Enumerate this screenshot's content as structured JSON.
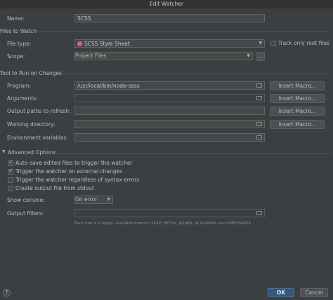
{
  "window": {
    "title": "Edit Watcher"
  },
  "name": {
    "label": "Name:",
    "value": "SCSS"
  },
  "files_to_watch": {
    "header": "Files to Watch",
    "file_type_label": "File type:",
    "file_type_value": "SCSS Style Sheet",
    "track_only_root_label": "Track only root files",
    "scope_label": "Scope:",
    "scope_value": "Project Files",
    "scope_browse": "..."
  },
  "tool": {
    "header": "Tool to Run on Changes",
    "program_label": "Program:",
    "program_value": "/usr/local/bin/node-sass",
    "arguments_label": "Arguments:",
    "output_paths_label": "Output paths to refresh:",
    "working_dir_label": "Working directory:",
    "env_vars_label": "Environment variables:",
    "insert_macro": "Insert Macro..."
  },
  "advanced": {
    "header": "Advanced Options",
    "options": [
      {
        "label": "Auto-save edited files to trigger the watcher",
        "checked": true
      },
      {
        "label": "Trigger the watcher on external changes",
        "checked": true
      },
      {
        "label": "Trigger the watcher regardless of syntax errors",
        "checked": false
      },
      {
        "label": "Create output file from stdout",
        "checked": false
      }
    ],
    "show_console_label": "Show console:",
    "show_console_value": "On error",
    "output_filters_label": "Output filters:",
    "hint": "Each line is a regex, available macros: $FILE_PATH$, $LINE$, $COLUMN$ and $MESSAGE$"
  },
  "footer": {
    "help": "?",
    "ok": "OK",
    "cancel": "Cancel"
  },
  "colors": {
    "background": "#3c3f41",
    "primary_button": "#365880",
    "sass_icon": "#cd6799"
  }
}
